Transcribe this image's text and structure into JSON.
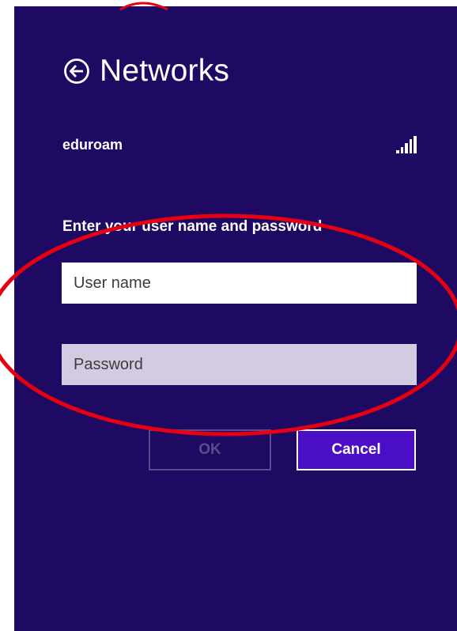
{
  "header": {
    "title": "Networks",
    "back_icon": "back-arrow-circle-icon"
  },
  "network": {
    "name": "eduroam",
    "signal_icon": "wifi-signal-icon",
    "signal_level": 1.0
  },
  "form": {
    "prompt": "Enter your user name and password",
    "username_placeholder": "User name",
    "username_value": "",
    "password_placeholder": "Password",
    "password_value": ""
  },
  "buttons": {
    "ok_label": "OK",
    "ok_enabled": false,
    "cancel_label": "Cancel"
  },
  "colors": {
    "panel_bg": "#1f0a63",
    "password_field_bg": "#d4cbe3",
    "cancel_bg": "#4a0fc4",
    "annotation_ellipse": "#e60012"
  }
}
